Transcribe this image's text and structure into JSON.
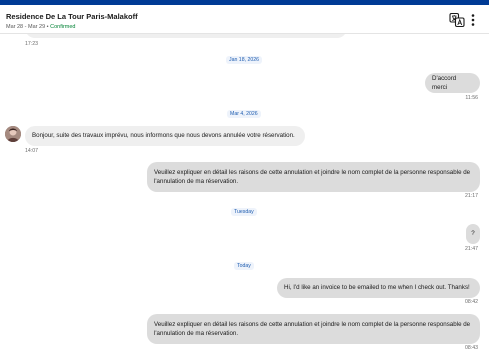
{
  "header": {
    "hotel_name": "Residence De La Tour Paris-Malakoff",
    "dates": "Mar 28 - Mar 29",
    "separator": " • ",
    "status": "Confirmed"
  },
  "icons": {
    "translate": "translate-icon",
    "more": "more-vertical-icon"
  },
  "colors": {
    "brand_bar": "#003b95",
    "confirmed": "#008234",
    "outgoing_bubble": "#dcdcdc",
    "incoming_bubble": "#efefef",
    "date_chip_text": "#1f5db0"
  },
  "thread": {
    "prev_time": "17:23",
    "dividers": {
      "jan18": "Jan 18, 2026",
      "mar4": "Mar 4, 2026",
      "tuesday": "Tuesday",
      "today": "Today"
    },
    "messages": [
      {
        "direction": "outgoing",
        "text": "D'accord merci",
        "time": "11:56"
      },
      {
        "direction": "incoming",
        "text": "Bonjour, suite des travaux imprévu, nous informons que nous devons annulée votre réservation.",
        "time": "14:07"
      },
      {
        "direction": "outgoing",
        "text": "Veuillez expliquer en détail les raisons de cette annulation et joindre le nom complet de la personne responsable de l'annulation de ma réservation.",
        "time": "21:17"
      },
      {
        "direction": "outgoing",
        "text": "?",
        "time": "21:47"
      },
      {
        "direction": "outgoing",
        "text": "Hi, I'd like an invoice to be emailed to me when I check out. Thanks!",
        "time": "08:42"
      },
      {
        "direction": "outgoing",
        "text": "Veuillez expliquer en détail les raisons de cette annulation et joindre le nom complet de la personne responsable de l'annulation de ma réservation.",
        "time": "08:43"
      }
    ]
  }
}
